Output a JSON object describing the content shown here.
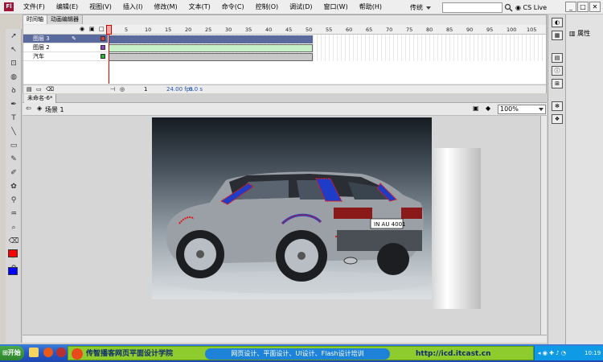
{
  "menubar": {
    "logo": "Fl",
    "items": [
      "文件(F)",
      "编辑(E)",
      "视图(V)",
      "插入(I)",
      "修改(M)",
      "文本(T)",
      "命令(C)",
      "控制(O)",
      "调试(D)",
      "窗口(W)",
      "帮助(H)"
    ],
    "workspace": "传统",
    "search_placeholder": "",
    "cs_live": "CS Live"
  },
  "timeline": {
    "tabs": [
      "时间轴",
      "动画编辑器"
    ],
    "layers": [
      {
        "name": "图层 3",
        "color": "#d04040",
        "selected": true
      },
      {
        "name": "图层 2",
        "color": "#9040c0",
        "selected": false
      },
      {
        "name": "汽车",
        "color": "#30b030",
        "selected": false
      }
    ],
    "ruler": [
      "1",
      "5",
      "10",
      "15",
      "20",
      "25",
      "30",
      "35",
      "40",
      "45",
      "50",
      "55",
      "60",
      "65",
      "70",
      "75",
      "80",
      "85",
      "90",
      "95",
      "100",
      "105",
      "110",
      "11"
    ],
    "current_frame": "1",
    "fps": "24.00 fps",
    "time": "0.0 s"
  },
  "document": {
    "tab": "未命名-6*",
    "scene": "场景 1",
    "zoom": "100%"
  },
  "right_panel": {
    "properties_label": "属性"
  },
  "taskbar": {
    "start": "开始",
    "banner_title": "传智播客网页平面设计学院",
    "banner_courses": "网页设计、平面设计、UI设计、Flash设计培训",
    "banner_url": "http://icd.itcast.cn",
    "clock": "10:19"
  },
  "colors": {
    "stroke": "#ff0000",
    "fill": "#0000ff",
    "accent": "#a0143a"
  },
  "tools": [
    "selection-icon",
    "subselect-icon",
    "free-transform-icon",
    "3d-rotate-icon",
    "lasso-icon",
    "pen-icon",
    "text-icon",
    "line-icon",
    "rectangle-icon",
    "pencil-icon",
    "brush-icon",
    "deco-icon",
    "bone-icon",
    "paint-bucket-icon",
    "eyedropper-icon",
    "eraser-icon",
    "hand-icon",
    "zoom-icon"
  ]
}
